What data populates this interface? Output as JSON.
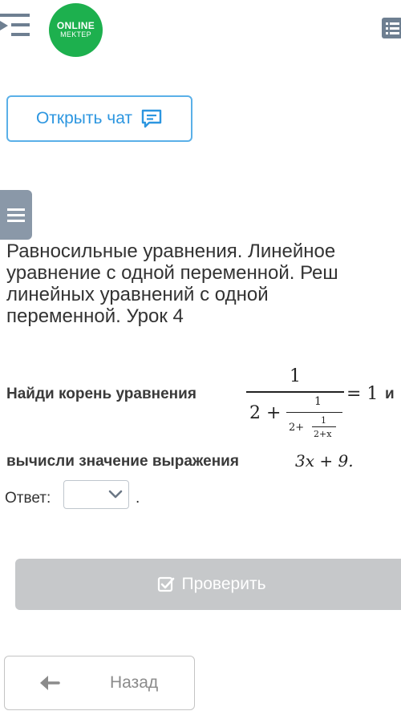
{
  "header": {
    "logo_line1": "ONLINE",
    "logo_line2": "MEKTEP"
  },
  "chat_button": {
    "label": "Открыть чат"
  },
  "lesson": {
    "title_lines": [
      "Равносильные уравнения. Линейное",
      "уравнение с одной переменной. Реш",
      "линейных уравнений с одной",
      "переменной. Урок 4"
    ]
  },
  "question": {
    "prefix": "Найди корень уравнения",
    "fraction_numerator": "1",
    "outer_whole": "2 +",
    "middle_numerator": "1",
    "middle_whole": "2+",
    "inner_numerator": "1",
    "inner_denominator": "2+x",
    "equals": "= 1",
    "suffix": "и",
    "line2_text": "вычисли значение выражения",
    "expression": "3x + 9."
  },
  "answer": {
    "label": "Ответ:",
    "selected_value": "",
    "trailing": "."
  },
  "check_button": {
    "label": "Проверить"
  },
  "back_button": {
    "label": "Назад"
  },
  "icons": {
    "menu": "menu-collapse-icon",
    "list": "list-icon",
    "chat": "chat-icon",
    "side": "hamburger-icon",
    "check": "checkbox-check-icon",
    "back": "arrow-left-icon",
    "dropdown": "chevron-down-icon"
  },
  "colors": {
    "brand_green": "#1db04e",
    "link_blue": "#2c96e0",
    "button_disabled": "#c6c8ca"
  }
}
